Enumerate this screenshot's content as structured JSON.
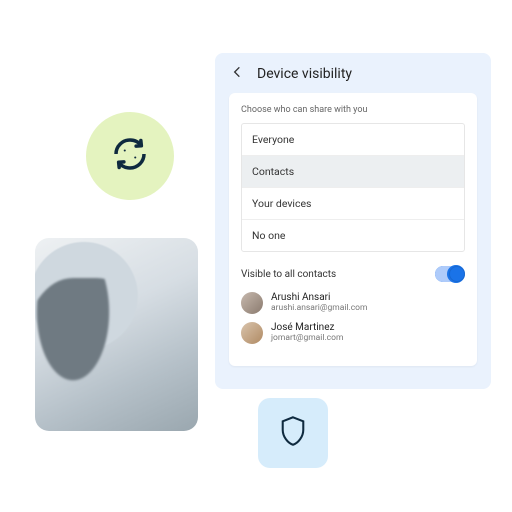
{
  "panel": {
    "title": "Device visibility",
    "choose_label": "Choose who can share with you",
    "options": [
      "Everyone",
      "Contacts",
      "Your devices",
      "No one"
    ],
    "selected_index": 1,
    "toggle_label": "Visible to all contacts",
    "toggle_on": true,
    "contacts": [
      {
        "name": "Arushi Ansari",
        "email": "arushi.ansari@gmail.com"
      },
      {
        "name": "José Martinez",
        "email": "jomart@gmail.com"
      }
    ]
  },
  "icons": {
    "swap": "swap-icon",
    "shield": "shield-icon",
    "back": "arrow-left-icon",
    "check": "check-icon"
  }
}
